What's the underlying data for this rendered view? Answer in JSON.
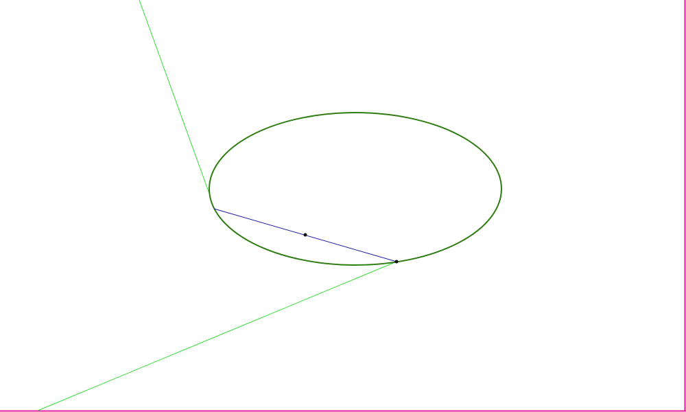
{
  "colors": {
    "background": "#ffffff",
    "frame": "#e0209a",
    "ellipse": "#2f7d12",
    "tangent_lines": "#33dd33",
    "chord": "#1a1aa8",
    "points": "#111111"
  },
  "diagram": {
    "shapes": [
      "ellipse",
      "tangent-line-1",
      "tangent-line-2",
      "chord",
      "chord-midpoint",
      "chord-endpoint"
    ]
  }
}
